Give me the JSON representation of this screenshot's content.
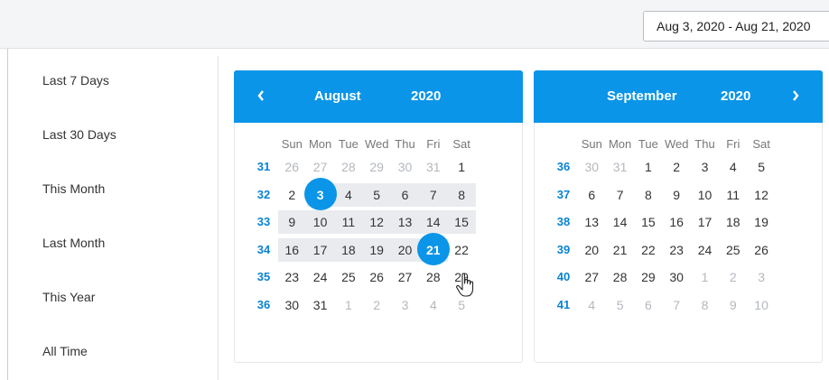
{
  "range_input": {
    "value": "Aug 3, 2020 - Aug 21, 2020"
  },
  "presets": [
    "Last 7 Days",
    "Last 30 Days",
    "This Month",
    "Last Month",
    "This Year",
    "All Time"
  ],
  "weekday_headers": [
    "Sun",
    "Mon",
    "Tue",
    "Wed",
    "Thu",
    "Fri",
    "Sat"
  ],
  "calendars": [
    {
      "month": "August",
      "year": "2020",
      "nav": "prev-chevron-icon",
      "weeks": [
        {
          "num": "31",
          "days": [
            "26",
            "27",
            "28",
            "29",
            "30",
            "31",
            "1"
          ],
          "muted": [
            0,
            1,
            2,
            3,
            4,
            5
          ]
        },
        {
          "num": "32",
          "days": [
            "2",
            "3",
            "4",
            "5",
            "6",
            "7",
            "8"
          ],
          "muted": []
        },
        {
          "num": "33",
          "days": [
            "9",
            "10",
            "11",
            "12",
            "13",
            "14",
            "15"
          ],
          "muted": []
        },
        {
          "num": "34",
          "days": [
            "16",
            "17",
            "18",
            "19",
            "20",
            "21",
            "22"
          ],
          "muted": []
        },
        {
          "num": "35",
          "days": [
            "23",
            "24",
            "25",
            "26",
            "27",
            "28",
            "29"
          ],
          "muted": []
        },
        {
          "num": "36",
          "days": [
            "30",
            "31",
            "1",
            "2",
            "3",
            "4",
            "5"
          ],
          "muted": [
            2,
            3,
            4,
            5,
            6
          ]
        }
      ],
      "range": {
        "start": {
          "week": 1,
          "day": 1
        },
        "end": {
          "week": 3,
          "day": 5
        }
      }
    },
    {
      "month": "September",
      "year": "2020",
      "nav": "next-chevron-icon",
      "weeks": [
        {
          "num": "36",
          "days": [
            "30",
            "31",
            "1",
            "2",
            "3",
            "4",
            "5"
          ],
          "muted": [
            0,
            1
          ]
        },
        {
          "num": "37",
          "days": [
            "6",
            "7",
            "8",
            "9",
            "10",
            "11",
            "12"
          ],
          "muted": []
        },
        {
          "num": "38",
          "days": [
            "13",
            "14",
            "15",
            "16",
            "17",
            "18",
            "19"
          ],
          "muted": []
        },
        {
          "num": "39",
          "days": [
            "20",
            "21",
            "22",
            "23",
            "24",
            "25",
            "26"
          ],
          "muted": []
        },
        {
          "num": "40",
          "days": [
            "27",
            "28",
            "29",
            "30",
            "1",
            "2",
            "3"
          ],
          "muted": [
            4,
            5,
            6
          ]
        },
        {
          "num": "41",
          "days": [
            "4",
            "5",
            "6",
            "7",
            "8",
            "9",
            "10"
          ],
          "muted": [
            0,
            1,
            2,
            3,
            4,
            5,
            6
          ]
        }
      ],
      "range": null
    }
  ],
  "colors": {
    "accent": "#0a95e8",
    "week_number": "#0a83d2",
    "range_band": "#e9ebee",
    "muted": "#b3b8be"
  }
}
